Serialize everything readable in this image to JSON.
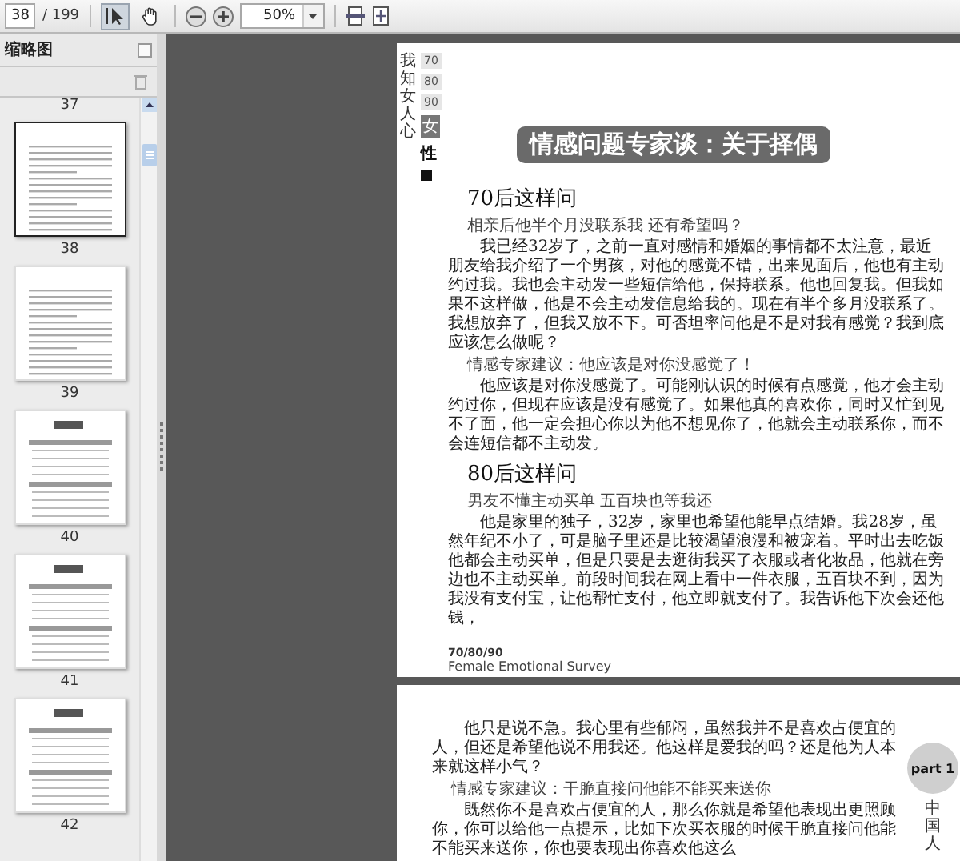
{
  "toolbar": {
    "page_number": "38",
    "page_count": "/ 199",
    "zoom": "50%",
    "tools": [
      {
        "kind": "select",
        "selected": true
      },
      {
        "kind": "hand",
        "selected": false
      }
    ]
  },
  "sidebar": {
    "title": "缩略图",
    "top_label": "37",
    "thumbnails": [
      {
        "label": "38",
        "selected": true,
        "kind": "text"
      },
      {
        "label": "39",
        "selected": false,
        "kind": "text"
      },
      {
        "label": "40",
        "selected": false,
        "kind": "table"
      },
      {
        "label": "41",
        "selected": false,
        "kind": "table"
      },
      {
        "label": "42",
        "selected": false,
        "kind": "table"
      }
    ]
  },
  "page_1": {
    "side_title": "我知女人心",
    "tags": [
      "70",
      "80",
      "90"
    ],
    "side_badge": "女",
    "side_char": "性",
    "banner": "情感问题专家谈：关于择偶",
    "blocks": [
      {
        "kind": "heading",
        "text": "70后这样问"
      },
      {
        "kind": "question",
        "text": "相亲后他半个月没联系我 还有希望吗？"
      },
      {
        "kind": "paragraph",
        "text": "我已经32岁了，之前一直对感情和婚姻的事情都不太注意，最近朋友给我介绍了一个男孩，对他的感觉不错，出来见面后，他也有主动约过我。我也会主动发一些短信给他，保持联系。他也回复我。但我如果不这样做，他是不会主动发信息给我的。现在有半个多月没联系了。我想放弃了，但我又放不下。可否坦率问他是不是对我有感觉？我到底应该怎么做呢？"
      },
      {
        "kind": "question",
        "text": "情感专家建议：他应该是对你没感觉了！"
      },
      {
        "kind": "paragraph",
        "text": "他应该是对你没感觉了。可能刚认识的时候有点感觉，他才会主动约过你，但现在应该是没有感觉了。如果他真的喜欢你，同时又忙到见不了面，他一定会担心你以为他不想见你了，他就会主动联系你，而不会连短信都不主动发。"
      },
      {
        "kind": "heading",
        "text": "80后这样问"
      },
      {
        "kind": "question",
        "text": "男友不懂主动买单 五百块也等我还"
      },
      {
        "kind": "paragraph",
        "text": "他是家里的独子，32岁，家里也希望他能早点结婚。我28岁，虽然年纪不小了，可是脑子里还是比较渴望浪漫和被宠着。平时出去吃饭他都会主动买单，但是只要是去逛街我买了衣服或者化妆品，他就在旁边也不主动买单。前段时间我在网上看中一件衣服，五百块不到，因为我没有支付宝，让他帮忙支付，他立即就支付了。我告诉他下次会还他钱，"
      }
    ],
    "footer": {
      "years": "70/80/90",
      "subtitle": "Female Emotional Survey"
    }
  },
  "page_2": {
    "part_badge": "part 1",
    "side_text": "中国人",
    "blocks": [
      {
        "kind": "paragraph",
        "text": "他只是说不急。我心里有些郁闷，虽然我并不是喜欢占便宜的人，但还是希望他说不用我还。他这样是爱我的吗？还是他为人本来就这样小气？"
      },
      {
        "kind": "question",
        "text": "情感专家建议：干脆直接问他能不能买来送你"
      },
      {
        "kind": "paragraph",
        "text": "既然你不是喜欢占便宜的人，那么你就是希望他表现出更照顾你，你可以给他一点提示，比如下次买衣服的时候干脆直接问他能不能买来送你，你也要表现出你喜欢他这么"
      }
    ]
  }
}
